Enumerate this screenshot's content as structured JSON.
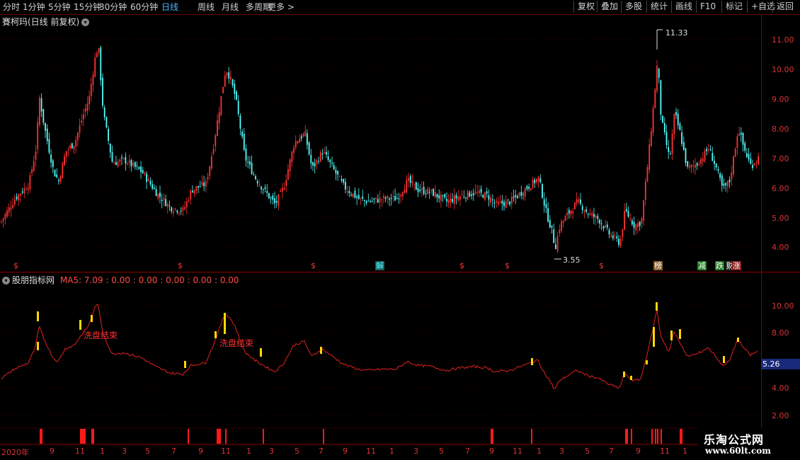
{
  "toolbar": {
    "periods": [
      "分时",
      "1分钟",
      "5分钟",
      "15分钟",
      "30分钟",
      "60分钟",
      "日线",
      "周线",
      "月线",
      "多周期",
      "更多 >"
    ],
    "active_period": "日线",
    "buttons": [
      "复权",
      "叠加",
      "多股",
      "统计",
      "画线",
      "F10",
      "标记",
      "+自选",
      "返回"
    ]
  },
  "main_chart": {
    "title": "賽柯玛(日线 前复权)",
    "y_ticks": [
      "11.00",
      "10.00",
      "9.00",
      "8.00",
      "7.00",
      "6.00",
      "5.00",
      "4.00"
    ],
    "high_label": "11.33",
    "low_label": "3.55",
    "colors": {
      "up": "#ff3232",
      "down": "#54ffff",
      "axis": "#dd3333"
    }
  },
  "event_markers": [
    {
      "text": "$",
      "color": "#ff3333",
      "bg": ""
    },
    {
      "text": "$",
      "color": "#ff3333",
      "bg": ""
    },
    {
      "text": "$",
      "color": "#ff3333",
      "bg": ""
    },
    {
      "text": "解",
      "color": "#54ffff",
      "bg": "#1d5a5a"
    },
    {
      "text": "$",
      "color": "#ff3333",
      "bg": ""
    },
    {
      "text": "$",
      "color": "#ff3333",
      "bg": ""
    },
    {
      "text": "$",
      "color": "#ff3333",
      "bg": ""
    },
    {
      "text": "榜",
      "color": "#ffffff",
      "bg": "#8a5a2a"
    },
    {
      "text": "减",
      "color": "#ffffff",
      "bg": "#1f7a1f"
    },
    {
      "text": "跌",
      "color": "#ffffff",
      "bg": "#1f7a1f"
    },
    {
      "text": "财",
      "color": "#ffffff",
      "bg": "#333333"
    },
    {
      "text": "涨",
      "color": "#ffffff",
      "bg": "#8a1a1a"
    }
  ],
  "indicator": {
    "name": "股朋指标网",
    "ma_label": "MA5: 7.09 : 0.00 : 0.00 : 0.00 : 0.00 : 0.00",
    "y_ticks": [
      "10.00",
      "8.00",
      "6.00",
      "4.00",
      "2.00"
    ],
    "last_value": "5.26",
    "annotations": [
      "洗盘结束",
      "洗盘结束"
    ]
  },
  "x_axis": [
    "2020年",
    "9",
    "11",
    "1",
    "3",
    "5",
    "7",
    "9",
    "11",
    "1",
    "3",
    "5",
    "7",
    "9",
    "11",
    "1",
    "3",
    "5",
    "7",
    "9",
    "11",
    "1",
    "3",
    "5",
    "7",
    "9",
    "11",
    "1"
  ],
  "watermark": {
    "title": "乐淘公式网",
    "url": "www.60lt.com"
  }
}
